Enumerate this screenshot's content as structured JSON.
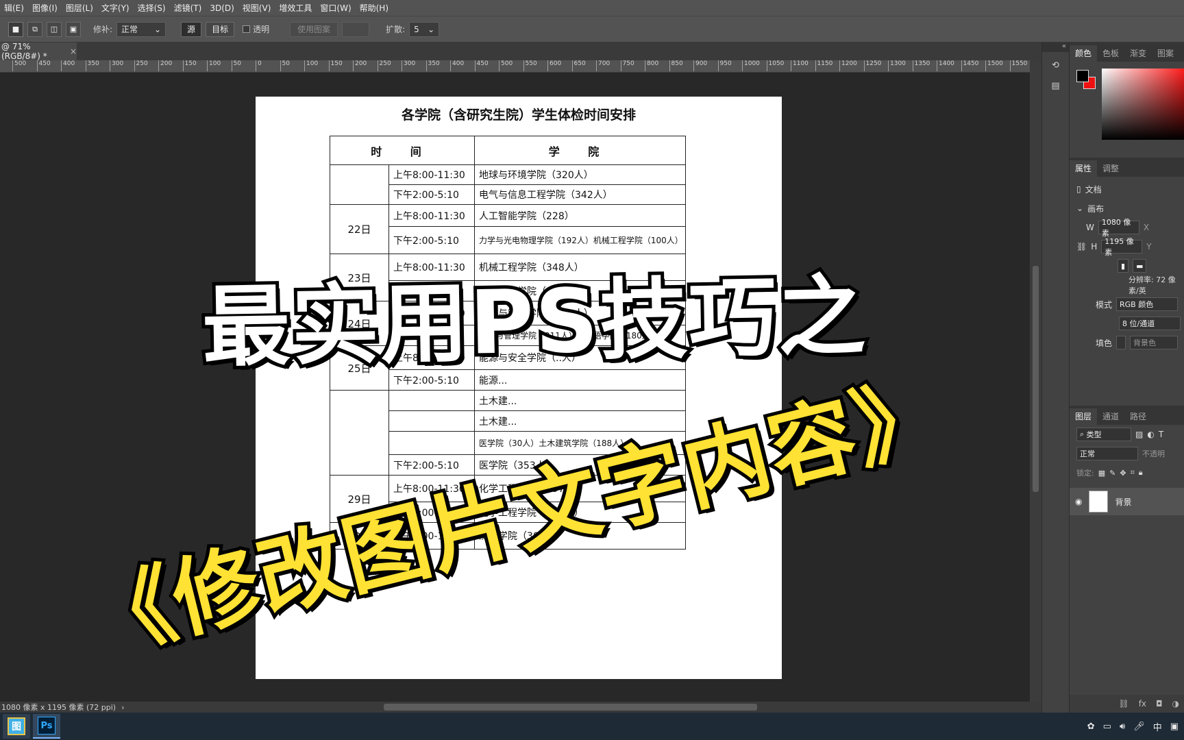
{
  "menu": [
    "辑(E)",
    "图像(I)",
    "图层(L)",
    "文字(Y)",
    "选择(S)",
    "滤镜(T)",
    "3D(D)",
    "视图(V)",
    "增效工具",
    "窗口(W)",
    "帮助(H)"
  ],
  "options": {
    "repair_label": "修补:",
    "repair_mode": "正常",
    "source_label": "源",
    "target_label": "目标",
    "transparent_label": "透明",
    "use_pattern_label": "使用图案",
    "diffusion_label": "扩散:",
    "diffusion_value": "5"
  },
  "tab": {
    "title": "@ 71%(RGB/8#) *",
    "close": "×"
  },
  "ruler_ticks": [
    "500",
    "450",
    "400",
    "350",
    "300",
    "250",
    "200",
    "150",
    "100",
    "50",
    "0",
    "50",
    "100",
    "150",
    "200",
    "250",
    "300",
    "350",
    "400",
    "450",
    "500",
    "550",
    "600",
    "650",
    "700",
    "750",
    "800",
    "850",
    "900",
    "950",
    "1000",
    "1050",
    "1100",
    "1150",
    "1200",
    "1250",
    "1300",
    "1350",
    "1400",
    "1450",
    "1500",
    "1550"
  ],
  "document": {
    "title": "各学院（含研究生院）学生体检时间安排",
    "headers": [
      "时 间",
      "学 院"
    ],
    "rows": [
      {
        "day": "",
        "time": "上午8:00-11:30",
        "college": "地球与环境学院（320人）"
      },
      {
        "day": "",
        "time": "下午2:00-5:10",
        "college": "电气与信息工程学院（342人）"
      },
      {
        "day": "22日",
        "time": "上午8:00-11:30",
        "college": "人工智能学院（228）"
      },
      {
        "day": "",
        "time": "下午2:00-5:10",
        "college": "力学与光电物理学院（192人）机械工程学院（100人）"
      },
      {
        "day": "23日",
        "time": "上午8:00-11:30",
        "college": "机械工程学院（348人）"
      },
      {
        "day": "",
        "time": "下午2:00-5:10",
        "college": "机械工程学院（347人）"
      },
      {
        "day": "24日",
        "time": "上午8:00-11:30",
        "college": "经济与管理学院（320人）"
      },
      {
        "day": "",
        "time": "下午2:00-5:10",
        "college": "经济与管理学院（211人）外国语学院（180人）"
      },
      {
        "day": "25日",
        "time": "上午8:00-11:30",
        "college": "能源与安全学院（..人）"
      },
      {
        "day": "",
        "time": "下午2:00-5:10",
        "college": "能源..."
      },
      {
        "day": "",
        "time": "",
        "college": "土木建..."
      },
      {
        "day": "",
        "time": "",
        "college": "土木建..."
      },
      {
        "day": "",
        "time": "",
        "college": "医学院（30人）土木建筑学院（188人）"
      },
      {
        "day": "",
        "time": "下午2:00-5:10",
        "college": "医学院（353人）"
      },
      {
        "day": "29日",
        "time": "上午8:00-11:30",
        "college": "化学工程学院（297人"
      },
      {
        "day": "",
        "time": "下午2:00-5:10",
        "college": "化学工程学院（296人）"
      },
      {
        "day": "30日",
        "time": "上午8:00-11:30",
        "college": "测绘学院（307人）"
      }
    ]
  },
  "overlay": {
    "line1": "最实用PS技巧之",
    "line2": "《修改图片文字内容》"
  },
  "status": {
    "text": "1080 像素 x 1195 像素 (72 ppi)",
    "arrow": "›"
  },
  "panels": {
    "color_tabs": [
      "颜色",
      "色板",
      "渐变",
      "图案"
    ],
    "prop_tabs": [
      "属性",
      "调整"
    ],
    "doc_label": "文档",
    "canvas_label": "画布",
    "w_label": "W",
    "w_value": "1080 像素",
    "h_label": "H",
    "h_value": "1195 像素",
    "x_label": "X",
    "y_label": "Y",
    "resolution": "分辨率: 72 像素/英",
    "mode_label": "模式",
    "mode_value": "RGB 颜色",
    "depth_value": "8 位/通道",
    "fill_label": "填色",
    "fill_value": "背景色",
    "layer_tabs": [
      "图层",
      "通道",
      "路径"
    ],
    "filter_kind": "类型",
    "blend_mode": "正常",
    "opacity_label": "不透明",
    "lock_label": "锁定:",
    "layer_name": "背景"
  },
  "taskbar": {
    "ps_label": "Ps",
    "app1_label": "图",
    "ime": "中"
  }
}
